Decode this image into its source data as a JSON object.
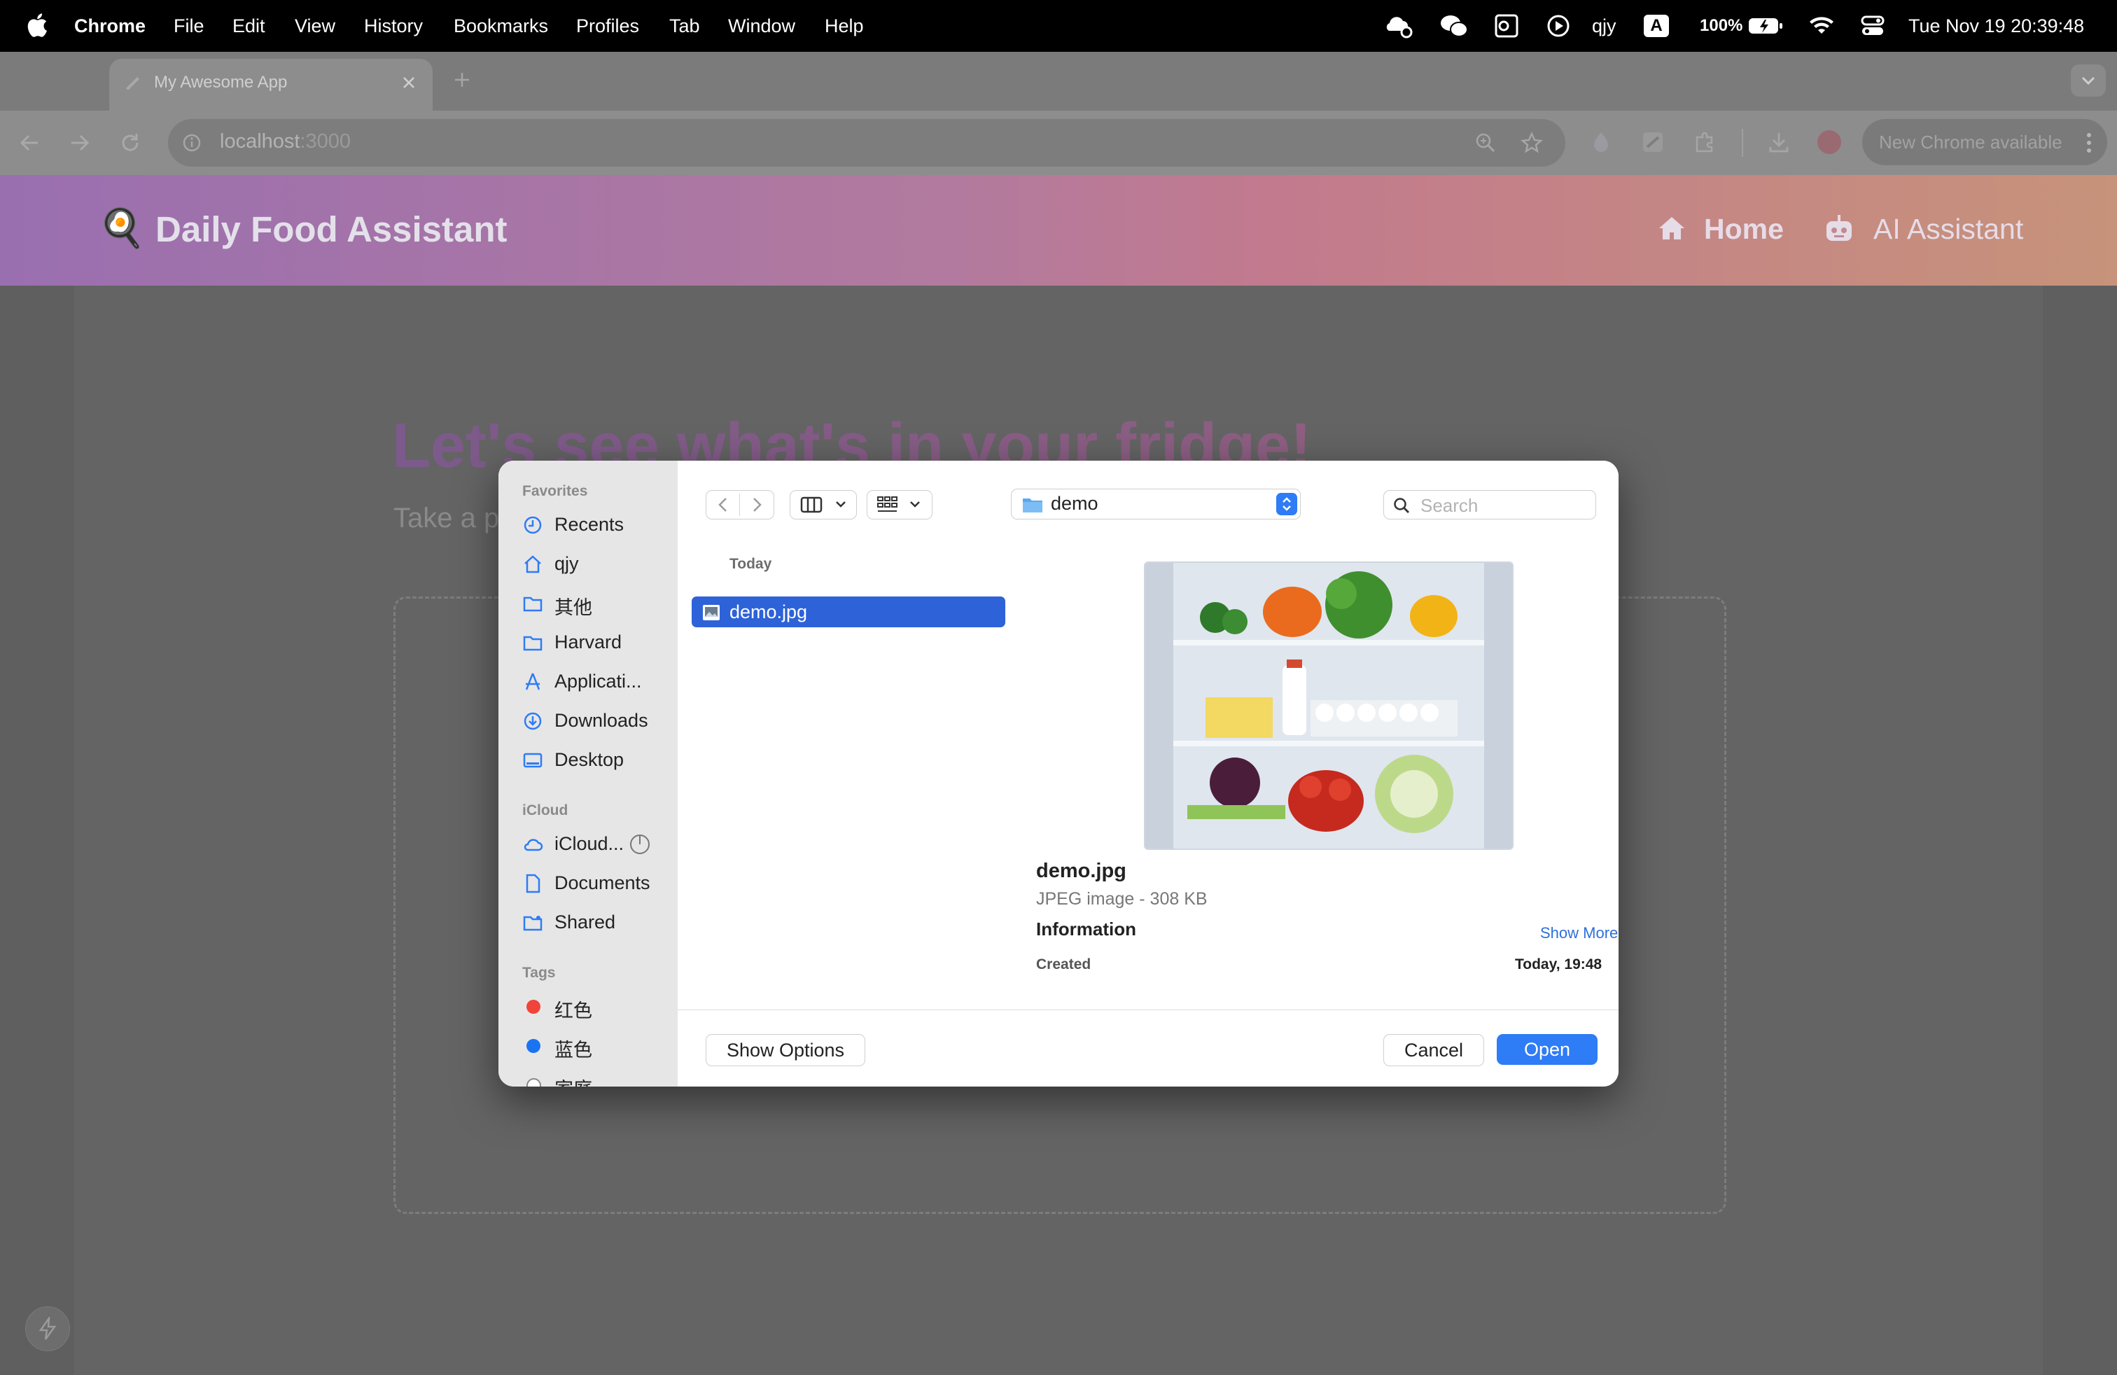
{
  "menubar": {
    "app_name": "Chrome",
    "items": [
      "File",
      "Edit",
      "View",
      "History",
      "Bookmarks",
      "Profiles",
      "Tab",
      "Window",
      "Help"
    ],
    "user": "qjy",
    "input_indicator": "A",
    "battery": "100%",
    "datetime": "Tue Nov 19  20:39:48"
  },
  "browser": {
    "tab_title": "My Awesome App",
    "url_host": "localhost",
    "url_port": ":3000",
    "update_label": "New Chrome available"
  },
  "app": {
    "logo": "🍳",
    "title": "Daily Food Assistant",
    "nav": {
      "home": "Home",
      "assistant": "AI Assistant"
    },
    "headline": "Let's see what's in your fridge!",
    "subtext": "Take a p"
  },
  "dialog": {
    "sidebar": {
      "favorites_label": "Favorites",
      "favorites": [
        "Recents",
        "qjy",
        "其他",
        "Harvard",
        "Applicati...",
        "Downloads",
        "Desktop"
      ],
      "icloud_label": "iCloud",
      "icloud": [
        "iCloud...",
        "Documents",
        "Shared"
      ],
      "tags_label": "Tags",
      "tags": [
        {
          "name": "红色",
          "color": "#f0443a"
        },
        {
          "name": "蓝色",
          "color": "#1a74f2"
        },
        {
          "name": "家庭",
          "color": "#ffffff"
        }
      ]
    },
    "location": "demo",
    "search_placeholder": "Search",
    "group_header": "Today",
    "selected_file": "demo.jpg",
    "preview": {
      "name": "demo.jpg",
      "kind": "JPEG image - 308 KB",
      "info_label": "Information",
      "show_more": "Show More",
      "created_label": "Created",
      "created_value": "Today, 19:48"
    },
    "buttons": {
      "show_options": "Show Options",
      "cancel": "Cancel",
      "open": "Open"
    },
    "accent": "#2e7cf6"
  }
}
